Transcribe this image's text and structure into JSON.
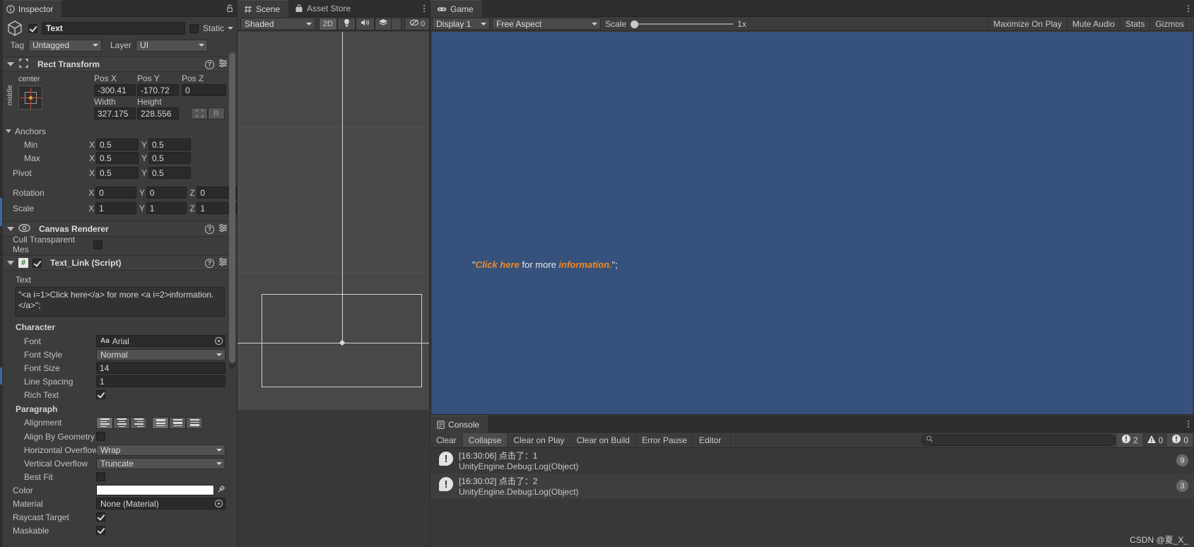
{
  "inspector": {
    "tab_label": "Inspector",
    "tab_icon": "info-icon",
    "lock_icon": "lock-open-icon",
    "object_name": "Text",
    "static_label": "Static",
    "tag_label": "Tag",
    "tag_value": "Untagged",
    "layer_label": "Layer",
    "layer_value": "UI",
    "rect_transform": {
      "title": "Rect Transform",
      "anchor_preset_top": "center",
      "anchor_preset_side": "middle",
      "col_posx": "Pos X",
      "col_posy": "Pos Y",
      "col_posz": "Pos Z",
      "posx": "-300.41",
      "posy": "-170.72",
      "posz": "0",
      "col_width": "Width",
      "col_height": "Height",
      "width": "327.175",
      "height": "228.556",
      "blueprint_btn": "R",
      "anchors_label": "Anchors",
      "min_label": "Min",
      "min_x": "0.5",
      "min_y": "0.5",
      "max_label": "Max",
      "max_x": "0.5",
      "max_y": "0.5",
      "pivot_label": "Pivot",
      "pivot_x": "0.5",
      "pivot_y": "0.5",
      "rotation_label": "Rotation",
      "rot_x": "0",
      "rot_y": "0",
      "rot_z": "0",
      "scale_label": "Scale",
      "scale_x": "1",
      "scale_y": "1",
      "scale_z": "1",
      "axis_x": "X",
      "axis_y": "Y",
      "axis_z": "Z"
    },
    "canvas_renderer": {
      "title": "Canvas Renderer",
      "cull_label": "Cull Transparent Mes"
    },
    "text_link": {
      "title": "Text_Link (Script)",
      "text_label": "Text",
      "text_value": "\"<a i=1>Click here</a> for more <a i=2>information.</a>\";",
      "character_label": "Character",
      "font_label": "Font",
      "font_value": "Arial",
      "font_style_label": "Font Style",
      "font_style_value": "Normal",
      "font_size_label": "Font Size",
      "font_size_value": "14",
      "line_spacing_label": "Line Spacing",
      "line_spacing_value": "1",
      "rich_text_label": "Rich Text",
      "paragraph_label": "Paragraph",
      "alignment_label": "Alignment",
      "align_by_geometry_label": "Align By Geometry",
      "horizontal_overflow_label": "Horizontal Overflow",
      "horizontal_overflow_value": "Wrap",
      "vertical_overflow_label": "Vertical Overflow",
      "vertical_overflow_value": "Truncate",
      "best_fit_label": "Best Fit",
      "color_label": "Color",
      "color_value": "#ffffff",
      "material_label": "Material",
      "material_value": "None (Material)",
      "raycast_target_label": "Raycast Target",
      "maskable_label": "Maskable"
    }
  },
  "scene": {
    "tab_label": "Scene",
    "tab_icon": "grid-icon",
    "asset_store_tab": "Asset Store",
    "asset_store_icon": "store-icon",
    "shading_mode": "Shaded",
    "mode_2d": "2D",
    "lighting_icon": "bulb-icon",
    "audio_icon": "speaker-icon",
    "fx_icon": "layers-icon",
    "gizmos_hidden_label": "0",
    "gizmos_hidden_icon": "eye-off-icon"
  },
  "game": {
    "tab_label": "Game",
    "tab_icon": "gamepad-icon",
    "display_value": "Display 1",
    "aspect_value": "Free Aspect",
    "scale_label": "Scale",
    "scale_value": "1x",
    "maximize_on_play": "Maximize On Play",
    "mute_audio": "Mute Audio",
    "stats": "Stats",
    "gizmos": "Gizmos",
    "rendered_text": {
      "open_quote": "\"",
      "link1": "Click here",
      "middle": " for more ",
      "link2": "information.",
      "close_quote": "\";"
    },
    "background_color": "#36527c",
    "link_color": "#f08a24"
  },
  "console": {
    "tab_label": "Console",
    "tab_icon": "console-icon",
    "clear_label": "Clear",
    "collapse_label": "Collapse",
    "clear_on_play_label": "Clear on Play",
    "clear_on_build_label": "Clear on Build",
    "error_pause_label": "Error Pause",
    "editor_label": "Editor",
    "search_placeholder": "",
    "search_icon": "search-icon",
    "counts": {
      "info": "2",
      "warning": "0",
      "error": "0"
    },
    "logs": [
      {
        "time": "[16:30:06]",
        "message": "点击了：1",
        "stack": "UnityEngine.Debug:Log(Object)",
        "badge": "9"
      },
      {
        "time": "[16:30:02]",
        "message": "点击了：2",
        "stack": "UnityEngine.Debug:Log(Object)",
        "badge": "3"
      }
    ]
  },
  "watermark": "CSDN @夏_X_"
}
